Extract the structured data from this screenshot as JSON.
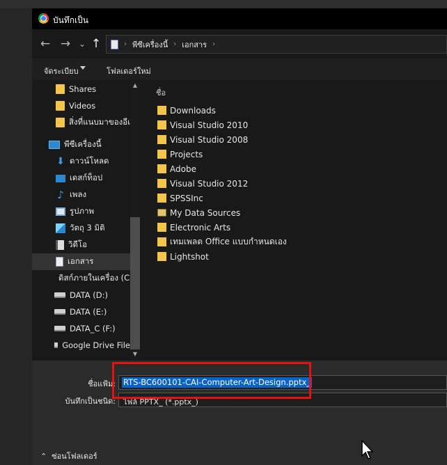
{
  "window": {
    "title": "บันทึกเป็น"
  },
  "nav": {
    "back_glyph": "←",
    "forward_glyph": "→",
    "dropdown_glyph": "⌄",
    "up_glyph": "↑",
    "breadcrumb": [
      "พีซีเครื่องนี้",
      "เอกสาร"
    ],
    "separator": "›"
  },
  "toolbar": {
    "organize": "จัดระเบียบ",
    "new_folder": "โฟลเดอร์ใหม่"
  },
  "sidebar": {
    "items": [
      {
        "label": "Shares",
        "icon": "folder-icon"
      },
      {
        "label": "Videos",
        "icon": "folder-icon"
      },
      {
        "label": "สิ่งที่แนบมาของอีเมล",
        "icon": "folder-icon"
      },
      {
        "label": "พีซีเครื่องนี้",
        "icon": "pc-icon"
      },
      {
        "label": "ดาวน์โหลด",
        "icon": "download-icon"
      },
      {
        "label": "เดสก์ท็อป",
        "icon": "desktop-icon"
      },
      {
        "label": "เพลง",
        "icon": "music-icon"
      },
      {
        "label": "รูปภาพ",
        "icon": "pictures-icon"
      },
      {
        "label": "วัตถุ 3 มิติ",
        "icon": "3d-objects-icon"
      },
      {
        "label": "วิดีโอ",
        "icon": "video-icon"
      },
      {
        "label": "เอกสาร",
        "icon": "documents-icon",
        "selected": true
      },
      {
        "label": "ดิสก์ภายในเครื่อง (C:",
        "icon": "drive-icon"
      },
      {
        "label": "DATA (D:)",
        "icon": "drive-icon"
      },
      {
        "label": "DATA (E:)",
        "icon": "drive-icon"
      },
      {
        "label": "DATA_C (F:)",
        "icon": "drive-icon"
      },
      {
        "label": "Google Drive File",
        "icon": "drive-icon"
      }
    ]
  },
  "file_list": {
    "column_name": "ชื่อ",
    "items": [
      {
        "label": "Downloads",
        "icon": "folder-icon"
      },
      {
        "label": "Visual Studio 2010",
        "icon": "folder-icon"
      },
      {
        "label": "Visual Studio 2008",
        "icon": "folder-icon"
      },
      {
        "label": "Projects",
        "icon": "folder-icon"
      },
      {
        "label": "Adobe",
        "icon": "folder-icon"
      },
      {
        "label": "Visual Studio 2012",
        "icon": "folder-icon"
      },
      {
        "label": "SPSSInc",
        "icon": "folder-icon"
      },
      {
        "label": "My Data Sources",
        "icon": "data-sources-icon"
      },
      {
        "label": "Electronic Arts",
        "icon": "folder-icon"
      },
      {
        "label": "เทมเพลต Office แบบกำหนดเอง",
        "icon": "folder-icon"
      },
      {
        "label": "Lightshot",
        "icon": "folder-icon"
      }
    ]
  },
  "save": {
    "filename_label": "ชื่อแฟ้ม:",
    "filename_value": "RTS-BC600101-CAI-Computer-Art-Design.pptx_",
    "type_label": "บันทึกเป็นชนิด:",
    "type_value": "ไฟล์ PPTX_ (*.pptx_)",
    "hide_folders": "ซ่อนโฟลเดอร์"
  },
  "colors": {
    "selection": "#0a64c8",
    "highlight_box": "#e61212",
    "folder": "#f3c64b"
  }
}
